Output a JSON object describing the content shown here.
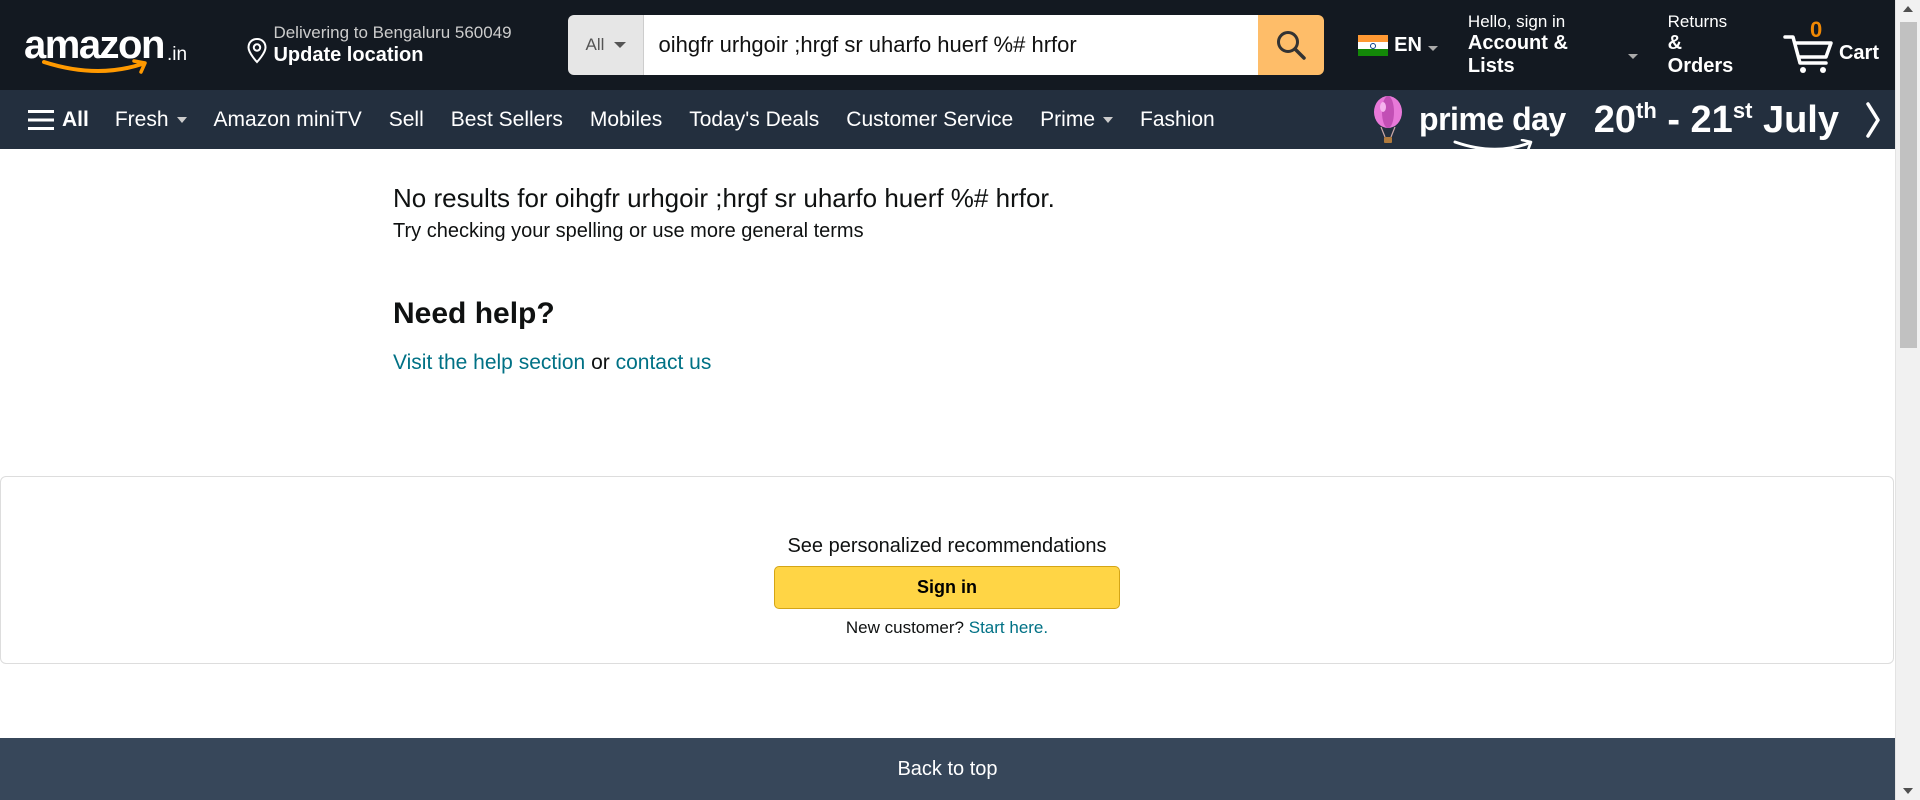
{
  "header": {
    "logo": {
      "word": "amazon",
      "tld": ".in"
    },
    "delivery": {
      "line1": "Delivering to Bengaluru 560049",
      "line2": "Update location"
    },
    "search": {
      "category": "All",
      "query": "oihgfr urhgoir ;hrgf sr uharfo huerf %# hrfor"
    },
    "language": "EN",
    "account": {
      "line1": "Hello, sign in",
      "line2": "Account & Lists"
    },
    "orders": {
      "line1": "Returns",
      "line2": "& Orders"
    },
    "cart": {
      "count": "0",
      "label": "Cart"
    }
  },
  "subnav": {
    "all_label": "All",
    "items": [
      {
        "label": "Fresh",
        "dropdown": true
      },
      {
        "label": "Amazon miniTV",
        "dropdown": false
      },
      {
        "label": "Sell",
        "dropdown": false
      },
      {
        "label": "Best Sellers",
        "dropdown": false
      },
      {
        "label": "Mobiles",
        "dropdown": false
      },
      {
        "label": "Today's Deals",
        "dropdown": false
      },
      {
        "label": "Customer Service",
        "dropdown": false
      },
      {
        "label": "Prime",
        "dropdown": true
      },
      {
        "label": "Fashion",
        "dropdown": false
      }
    ],
    "promo": {
      "brand": "prime day",
      "date_from": "20",
      "from_suffix": "th",
      "separator": "-",
      "date_to": "21",
      "to_suffix": "st",
      "month": "July"
    }
  },
  "main": {
    "no_results": "No results for oihgfr urhgoir ;hrgf sr uharfo huerf %# hrfor.",
    "suggestion": "Try checking your spelling or use more general terms",
    "help_heading": "Need help?",
    "help_link": "Visit the help section",
    "help_or": "or",
    "contact_link": "contact us"
  },
  "recommendations": {
    "title": "See personalized recommendations",
    "signin_label": "Sign in",
    "new_customer": "New customer?",
    "start_link": "Start here."
  },
  "footer": {
    "back_to_top": "Back to top"
  },
  "colors": {
    "nav_bg": "#131921",
    "subnav_bg": "#232f3e",
    "search_button": "#febd69",
    "signin_button": "#ffd545",
    "link": "#007185",
    "cart_count": "#f08804",
    "back_to_top_bg": "#37475a"
  }
}
